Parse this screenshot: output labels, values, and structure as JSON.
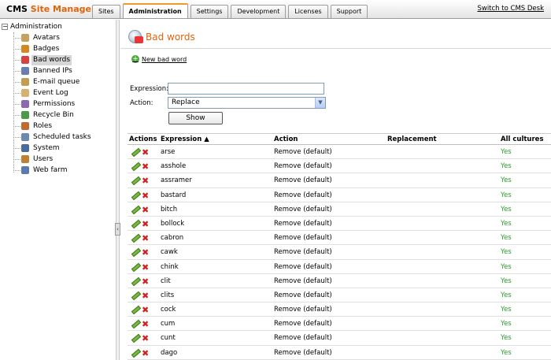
{
  "header": {
    "logo_part1": "CMS",
    "logo_part2": "Site Manager",
    "tabs": [
      "Sites",
      "Administration",
      "Settings",
      "Development",
      "Licenses",
      "Support"
    ],
    "active_tab": "Administration",
    "switch_link": "Switch to CMS Desk"
  },
  "tree": {
    "root": "Administration",
    "items": [
      {
        "label": "Avatars",
        "icon": "avatar-icon",
        "color": "#c8a060"
      },
      {
        "label": "Badges",
        "icon": "badge-icon",
        "color": "#d08a20"
      },
      {
        "label": "Bad words",
        "icon": "bad-words-icon",
        "color": "#d94040",
        "selected": true
      },
      {
        "label": "Banned IPs",
        "icon": "banned-ip-icon",
        "color": "#6a7fb0"
      },
      {
        "label": "E-mail queue",
        "icon": "email-icon",
        "color": "#c0a050"
      },
      {
        "label": "Event Log",
        "icon": "event-log-icon",
        "color": "#d8b070"
      },
      {
        "label": "Permissions",
        "icon": "permissions-icon",
        "color": "#8a6ab0"
      },
      {
        "label": "Recycle Bin",
        "icon": "recycle-bin-icon",
        "color": "#4a9a4a"
      },
      {
        "label": "Roles",
        "icon": "roles-icon",
        "color": "#c06a30"
      },
      {
        "label": "Scheduled tasks",
        "icon": "clock-icon",
        "color": "#6a8ab0"
      },
      {
        "label": "System",
        "icon": "system-icon",
        "color": "#4a6aa0"
      },
      {
        "label": "Users",
        "icon": "users-icon",
        "color": "#c08030"
      },
      {
        "label": "Web farm",
        "icon": "web-farm-icon",
        "color": "#5a7ab0"
      }
    ]
  },
  "page": {
    "title": "Bad words",
    "new_link": "New bad word"
  },
  "filter": {
    "expression_label": "Expression:",
    "expression_value": "",
    "action_label": "Action:",
    "action_value": "Replace",
    "show_button": "Show"
  },
  "grid": {
    "columns": [
      "Actions",
      "Expression ▲",
      "Action",
      "Replacement",
      "All cultures"
    ],
    "rows": [
      {
        "expression": "arse",
        "action": "Remove (default)",
        "replacement": "",
        "all_cultures": "Yes"
      },
      {
        "expression": "asshole",
        "action": "Remove (default)",
        "replacement": "",
        "all_cultures": "Yes"
      },
      {
        "expression": "assramer",
        "action": "Remove (default)",
        "replacement": "",
        "all_cultures": "Yes"
      },
      {
        "expression": "bastard",
        "action": "Remove (default)",
        "replacement": "",
        "all_cultures": "Yes"
      },
      {
        "expression": "bitch",
        "action": "Remove (default)",
        "replacement": "",
        "all_cultures": "Yes"
      },
      {
        "expression": "bollock",
        "action": "Remove (default)",
        "replacement": "",
        "all_cultures": "Yes"
      },
      {
        "expression": "cabron",
        "action": "Remove (default)",
        "replacement": "",
        "all_cultures": "Yes"
      },
      {
        "expression": "cawk",
        "action": "Remove (default)",
        "replacement": "",
        "all_cultures": "Yes"
      },
      {
        "expression": "chink",
        "action": "Remove (default)",
        "replacement": "",
        "all_cultures": "Yes"
      },
      {
        "expression": "clit",
        "action": "Remove (default)",
        "replacement": "",
        "all_cultures": "Yes"
      },
      {
        "expression": "clits",
        "action": "Remove (default)",
        "replacement": "",
        "all_cultures": "Yes"
      },
      {
        "expression": "cock",
        "action": "Remove (default)",
        "replacement": "",
        "all_cultures": "Yes"
      },
      {
        "expression": "cum",
        "action": "Remove (default)",
        "replacement": "",
        "all_cultures": "Yes"
      },
      {
        "expression": "cunt",
        "action": "Remove (default)",
        "replacement": "",
        "all_cultures": "Yes"
      },
      {
        "expression": "dago",
        "action": "Remove (default)",
        "replacement": "",
        "all_cultures": "Yes"
      }
    ]
  }
}
